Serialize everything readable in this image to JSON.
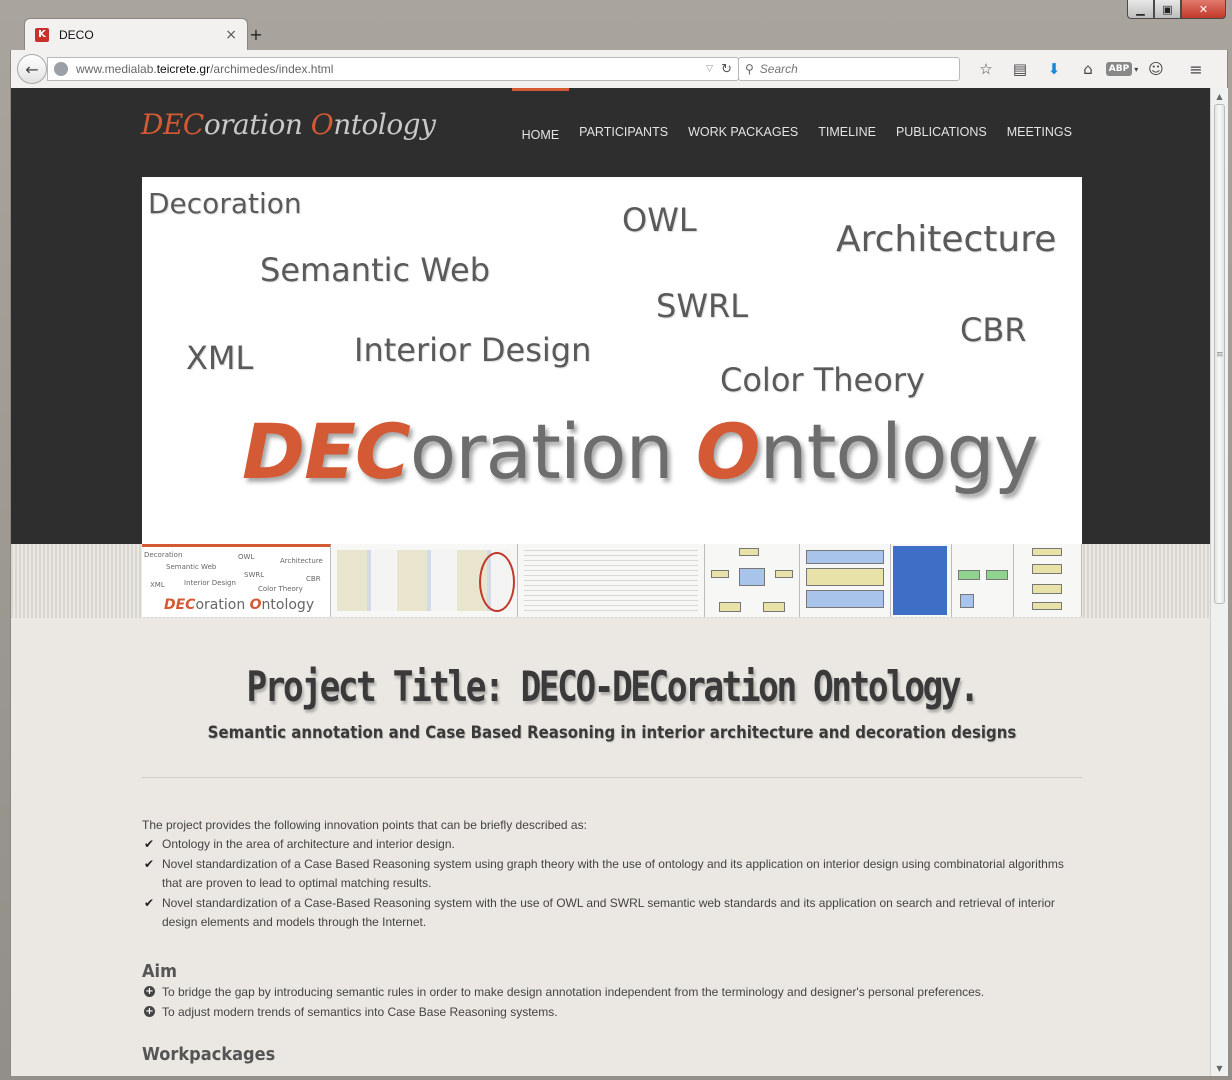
{
  "browser": {
    "tab_title": "DECO",
    "tab_close": "×",
    "new_tab": "+",
    "url_prefix": "www.medialab.",
    "url_domain": "teicrete.gr",
    "url_path": "/archimedes/index.html",
    "search_placeholder": "Search",
    "toolbar_icons": [
      "star-icon",
      "reading-list-icon",
      "download-icon",
      "home-icon",
      "adblock-icon",
      "chat-icon",
      "menu-icon"
    ],
    "abp_label": "ABP"
  },
  "site": {
    "logo": {
      "part1": "DEC",
      "part2": "oration ",
      "part3": "O",
      "part4": "ntology"
    },
    "nav": [
      "HOME",
      "PARTICIPANTS",
      "WORK PACKAGES",
      "TIMELINE",
      "PUBLICATIONS",
      "MEETINGS"
    ],
    "active_nav": "HOME",
    "accent_color": "#d35a34"
  },
  "hero": {
    "words": [
      "Decoration",
      "OWL",
      "Architecture",
      "Semantic Web",
      "SWRL",
      "CBR",
      "XML",
      "Interior Design",
      "Color Theory"
    ],
    "title": {
      "part1": "DEC",
      "part2": "oration ",
      "part3": "O",
      "part4": "ntology"
    }
  },
  "thumbs": {
    "first_words": [
      "Decoration",
      "OWL",
      "Architecture",
      "Semantic Web",
      "SWRL",
      "CBR",
      "XML",
      "Interior Design",
      "Color Theory"
    ],
    "first_title": {
      "part1": "DEC",
      "part2": "oration ",
      "part3": "O",
      "part4": "ntology"
    }
  },
  "content": {
    "project_title": "Project Title: DECO-DECoration Ontology.",
    "project_subtitle": "Semantic annotation and Case Based Reasoning in interior architecture and decoration designs",
    "intro": "The project provides the following innovation points that can be briefly described as:",
    "points": [
      "Ontology in the area of architecture and interior design.",
      "Novel standardization of a Case Based Reasoning system using graph theory with the use of ontology and its application on interior design using combinatorial algorithms that are proven to lead to optimal matching results.",
      "Novel standardization of a Case-Based Reasoning system with the use of OWL and SWRL semantic web standards and its application on search and retrieval of interior design elements and models through the Internet."
    ],
    "aim_heading": "Aim",
    "aims": [
      "To bridge the gap by introducing semantic rules in order to make design annotation independent from the terminology and designer's personal preferences.",
      "To adjust modern trends of semantics into Case Base Reasoning systems."
    ],
    "workpackages_heading": "Workpackages"
  }
}
